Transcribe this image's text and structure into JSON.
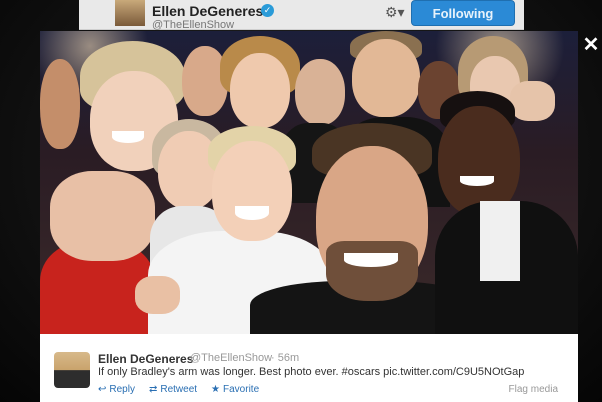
{
  "header": {
    "name": "Ellen DeGeneres",
    "handle": "@TheEllenShow",
    "follow_label": "Following",
    "gear_icon": "gear-icon",
    "verified_icon": "verified-badge-icon"
  },
  "lightbox": {
    "close_label": "✕"
  },
  "tweet": {
    "name": "Ellen DeGeneres",
    "handle": "@TheEllenShow",
    "separator": "·",
    "time": "56m",
    "text": "If only Bradley's arm was longer. Best photo ever. #oscars pic.twitter.com/C9U5NOtGap",
    "actions": [
      {
        "label": "Reply",
        "icon": "reply-icon"
      },
      {
        "label": "Retweet",
        "icon": "retweet-icon"
      },
      {
        "label": "Favorite",
        "icon": "star-icon"
      }
    ],
    "flag_label": "Flag media"
  },
  "colors": {
    "follow_button": "#2b8ad6",
    "link": "#2a6fb3",
    "verified": "#2a9bd8"
  }
}
